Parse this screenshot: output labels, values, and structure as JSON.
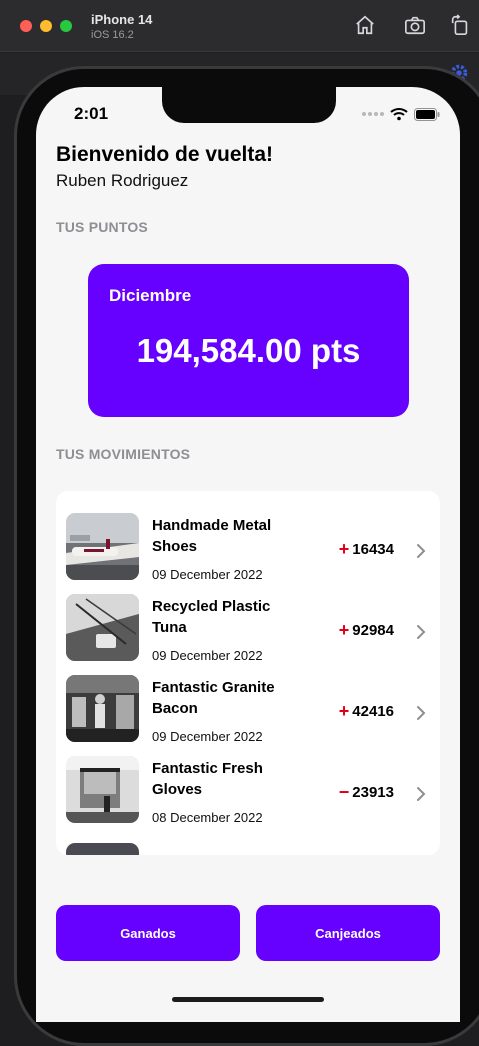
{
  "simulator": {
    "device_name": "iPhone 14",
    "os_version": "iOS 16.2",
    "icons": [
      "home-icon",
      "screenshot-icon",
      "rotate-icon",
      "gear-icon"
    ]
  },
  "status_bar": {
    "time": "2:01"
  },
  "header": {
    "greeting": "Bienvenido de vuelta!",
    "username": "Ruben Rodriguez"
  },
  "points": {
    "section_label": "TUS PUNTOS",
    "month": "Diciembre",
    "value": "194,584.00 pts"
  },
  "movements": {
    "section_label": "TUS MOVIMIENTOS",
    "items": [
      {
        "title": "Handmade Metal Shoes",
        "date": "09 December 2022",
        "sign": "+",
        "amount": "16434",
        "type": "earned"
      },
      {
        "title": "Recycled Plastic Tuna",
        "date": "09 December 2022",
        "sign": "+",
        "amount": "92984",
        "type": "earned"
      },
      {
        "title": "Fantastic Granite Bacon",
        "date": "09 December 2022",
        "sign": "+",
        "amount": "42416",
        "type": "earned"
      },
      {
        "title": "Fantastic Fresh Gloves",
        "date": "08 December 2022",
        "sign": "−",
        "amount": "23913",
        "type": "redeemed"
      }
    ]
  },
  "actions": {
    "earned_label": "Ganados",
    "redeemed_label": "Canjeados"
  },
  "colors": {
    "accent": "#6600ff",
    "sign": "#e0001a",
    "background": "#f6f6f7"
  }
}
